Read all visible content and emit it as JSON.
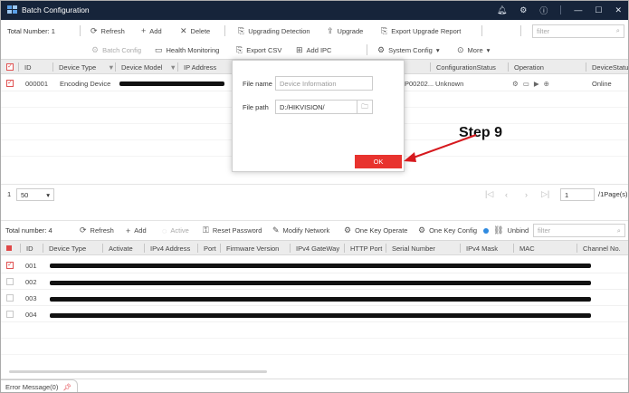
{
  "title": "Batch Configuration",
  "colors": {
    "accent": "#e8332e",
    "titlebar": "#16243a"
  },
  "top": {
    "total_label": "Total Number: 1",
    "actions": [
      "Refresh",
      "Add",
      "Delete",
      "Upgrading Detection",
      "Upgrade",
      "Export Upgrade Report"
    ],
    "actions2": [
      "Batch Config",
      "Health Monitoring",
      "Export CSV",
      "Add IPC",
      "System Config",
      "More"
    ],
    "filter_placeholder": "filter",
    "columns": [
      "ID",
      "Device Type",
      "Device Model",
      "IP Address",
      "ConfigurationStatus",
      "Operation",
      "DeviceStatus"
    ],
    "row": {
      "id": "000001",
      "type": "Encoding Device",
      "partial": "P00202...",
      "config_status": "Unknown",
      "device_status": "Online"
    }
  },
  "dialog": {
    "file_name_label": "File name",
    "file_name_placeholder": "Device Information",
    "file_path_label": "File path",
    "file_path_value": "D:/HIKVISION/",
    "ok_label": "OK"
  },
  "annotation": {
    "step": "Step 9"
  },
  "pager": {
    "page_size": "50",
    "page_input": "1",
    "page_info": "/1Page(s)"
  },
  "bottom": {
    "total_label": "Total number: 4",
    "actions": [
      "Refresh",
      "Add",
      "Active",
      "Reset Password",
      "Modify Network",
      "One Key Operate",
      "One Key Config",
      "Unbind"
    ],
    "filter_placeholder": "filter",
    "columns": [
      "ID",
      "Device Type",
      "Activate",
      "IPv4 Address",
      "Port",
      "Firmware Version",
      "IPv4 GateWay",
      "HTTP Port",
      "Serial Number",
      "IPv4 Mask",
      "MAC",
      "Channel No."
    ],
    "rows": [
      "001",
      "002",
      "003",
      "004"
    ]
  },
  "status": {
    "error_tab": "Error Message(0)"
  }
}
